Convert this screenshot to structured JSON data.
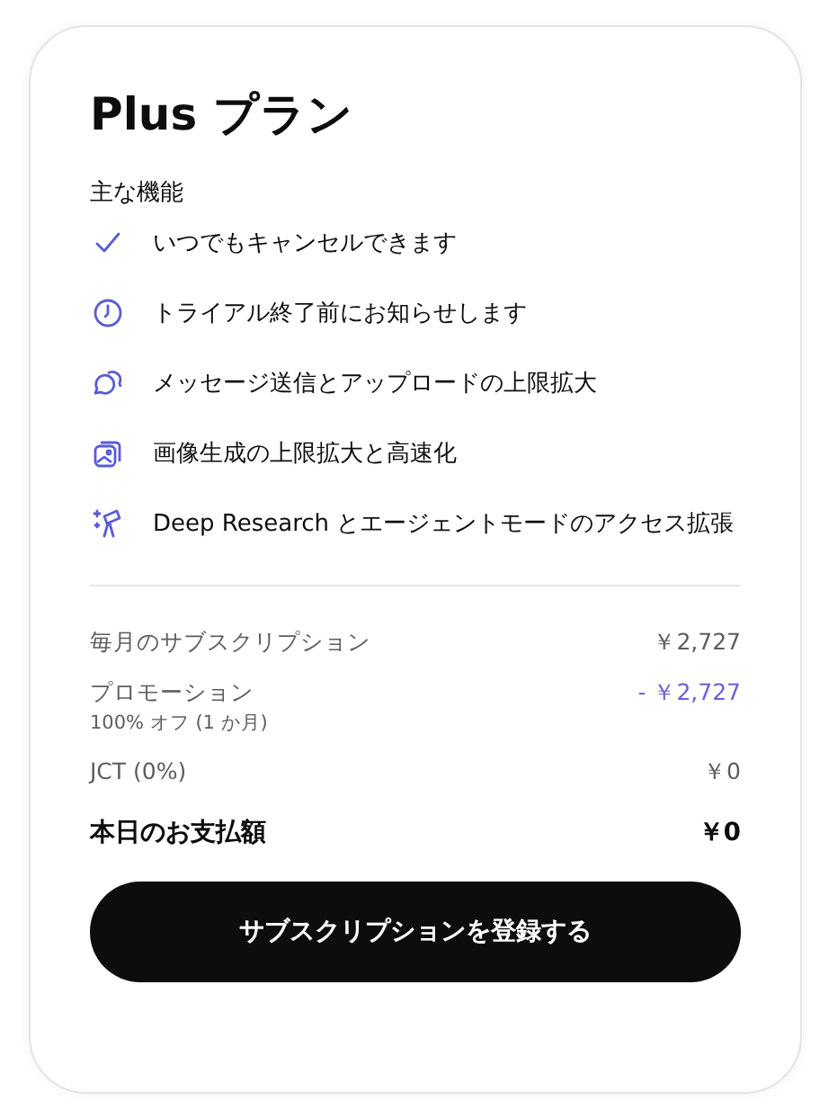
{
  "title": "Plus プラン",
  "features_heading": "主な機能",
  "features": [
    {
      "kind": "check",
      "text": "いつでもキャンセルできます"
    },
    {
      "kind": "clock",
      "text": "トライアル終了前にお知らせします"
    },
    {
      "kind": "chat",
      "text": "メッセージ送信とアップロードの上限拡大"
    },
    {
      "kind": "image",
      "text": "画像生成の上限拡大と高速化"
    },
    {
      "kind": "telescope",
      "text": "Deep Research とエージェントモードのアクセス拡張"
    }
  ],
  "line_items": [
    {
      "kind": "normal",
      "label": "毎月のサブスクリプション",
      "amount": "￥2,727"
    },
    {
      "kind": "discount",
      "label": "プロモーション",
      "note": "100% オフ (1 か月)",
      "amount": "- ￥2,727"
    },
    {
      "kind": "normal",
      "label": "JCT (0%)",
      "amount": "￥0"
    },
    {
      "kind": "total",
      "label": "本日のお支払額",
      "amount": "￥0"
    }
  ],
  "subscribe_button": "サブスクリプションを登録する"
}
